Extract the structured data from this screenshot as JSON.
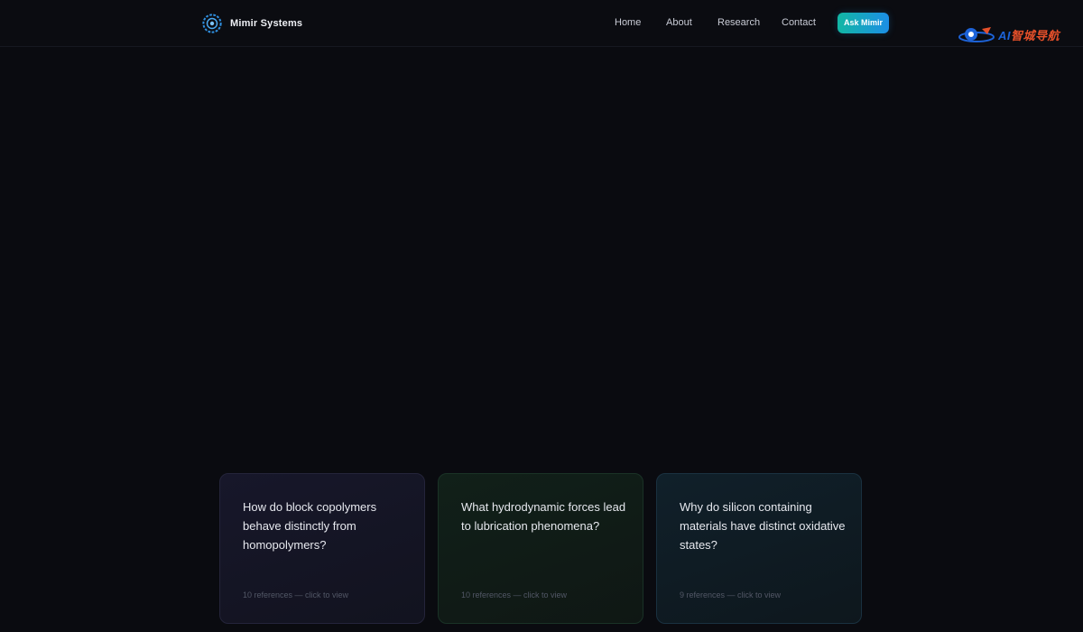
{
  "brand": {
    "name": "Mimir Systems",
    "logo_icon": "gear-icon"
  },
  "nav": {
    "links": [
      {
        "label": "Home"
      },
      {
        "label": "About"
      },
      {
        "label": "Research"
      },
      {
        "label": "Contact"
      }
    ],
    "cta_label": "Ask Mimir"
  },
  "watermark": {
    "prefix": "AI",
    "suffix": "智城导航"
  },
  "cards": [
    {
      "question": "How do block copolymers behave distinctly from homopolymers?",
      "meta": "10 references — click to view"
    },
    {
      "question": "What hydrodynamic forces lead to lubrication phenomena?",
      "meta": "10 references — click to view"
    },
    {
      "question": "Why do silicon containing materials have distinct oxidative states?",
      "meta": "9 references — click to view"
    }
  ],
  "colors": {
    "background": "#0a0b10",
    "accent_start": "#12b7a4",
    "accent_end": "#1c8ee6"
  }
}
